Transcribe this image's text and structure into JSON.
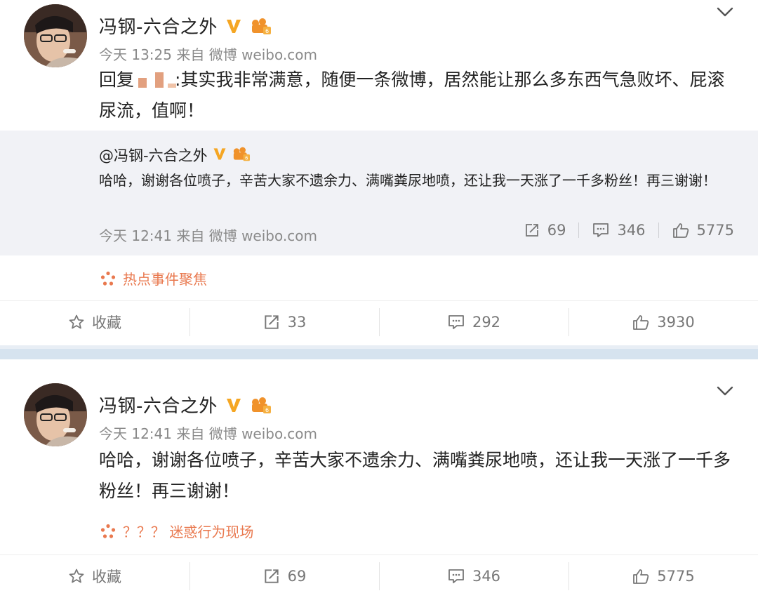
{
  "colors": {
    "accent_orange": "#e9794f",
    "verified_gold": "#f5a623",
    "quote_bg": "#f1f2f6",
    "divider": "#d6e3ef"
  },
  "post1": {
    "author": "冯钢-六合之外",
    "meta": "今天 13:25 来自 微博 weibo.com",
    "body_prefix": "回复",
    "body_rest": ":其实我非常满意，随便一条微博，居然能让那么多东西气急败坏、屁滚尿流，值啊！",
    "quote": {
      "author": "@冯钢-六合之外",
      "text": "哈哈，谢谢各位喷子，辛苦大家不遗余力、满嘴粪尿地喷，还让我一天涨了一千多粉丝！再三谢谢！",
      "meta": "今天 12:41 来自 微博 weibo.com",
      "reposts": "69",
      "comments": "346",
      "likes": "5775"
    },
    "topic": "热点事件聚焦",
    "actions": {
      "favorite": "收藏",
      "reposts": "33",
      "comments": "292",
      "likes": "3930"
    }
  },
  "post2": {
    "author": "冯钢-六合之外",
    "meta": "今天 12:41 来自 微博 weibo.com",
    "body": "哈哈，谢谢各位喷子，辛苦大家不遗余力、满嘴粪尿地喷，还让我一天涨了一千多粉丝！再三谢谢！",
    "topic": "？？？ 迷惑行为现场",
    "actions": {
      "favorite": "收藏",
      "reposts": "69",
      "comments": "346",
      "likes": "5775"
    }
  }
}
